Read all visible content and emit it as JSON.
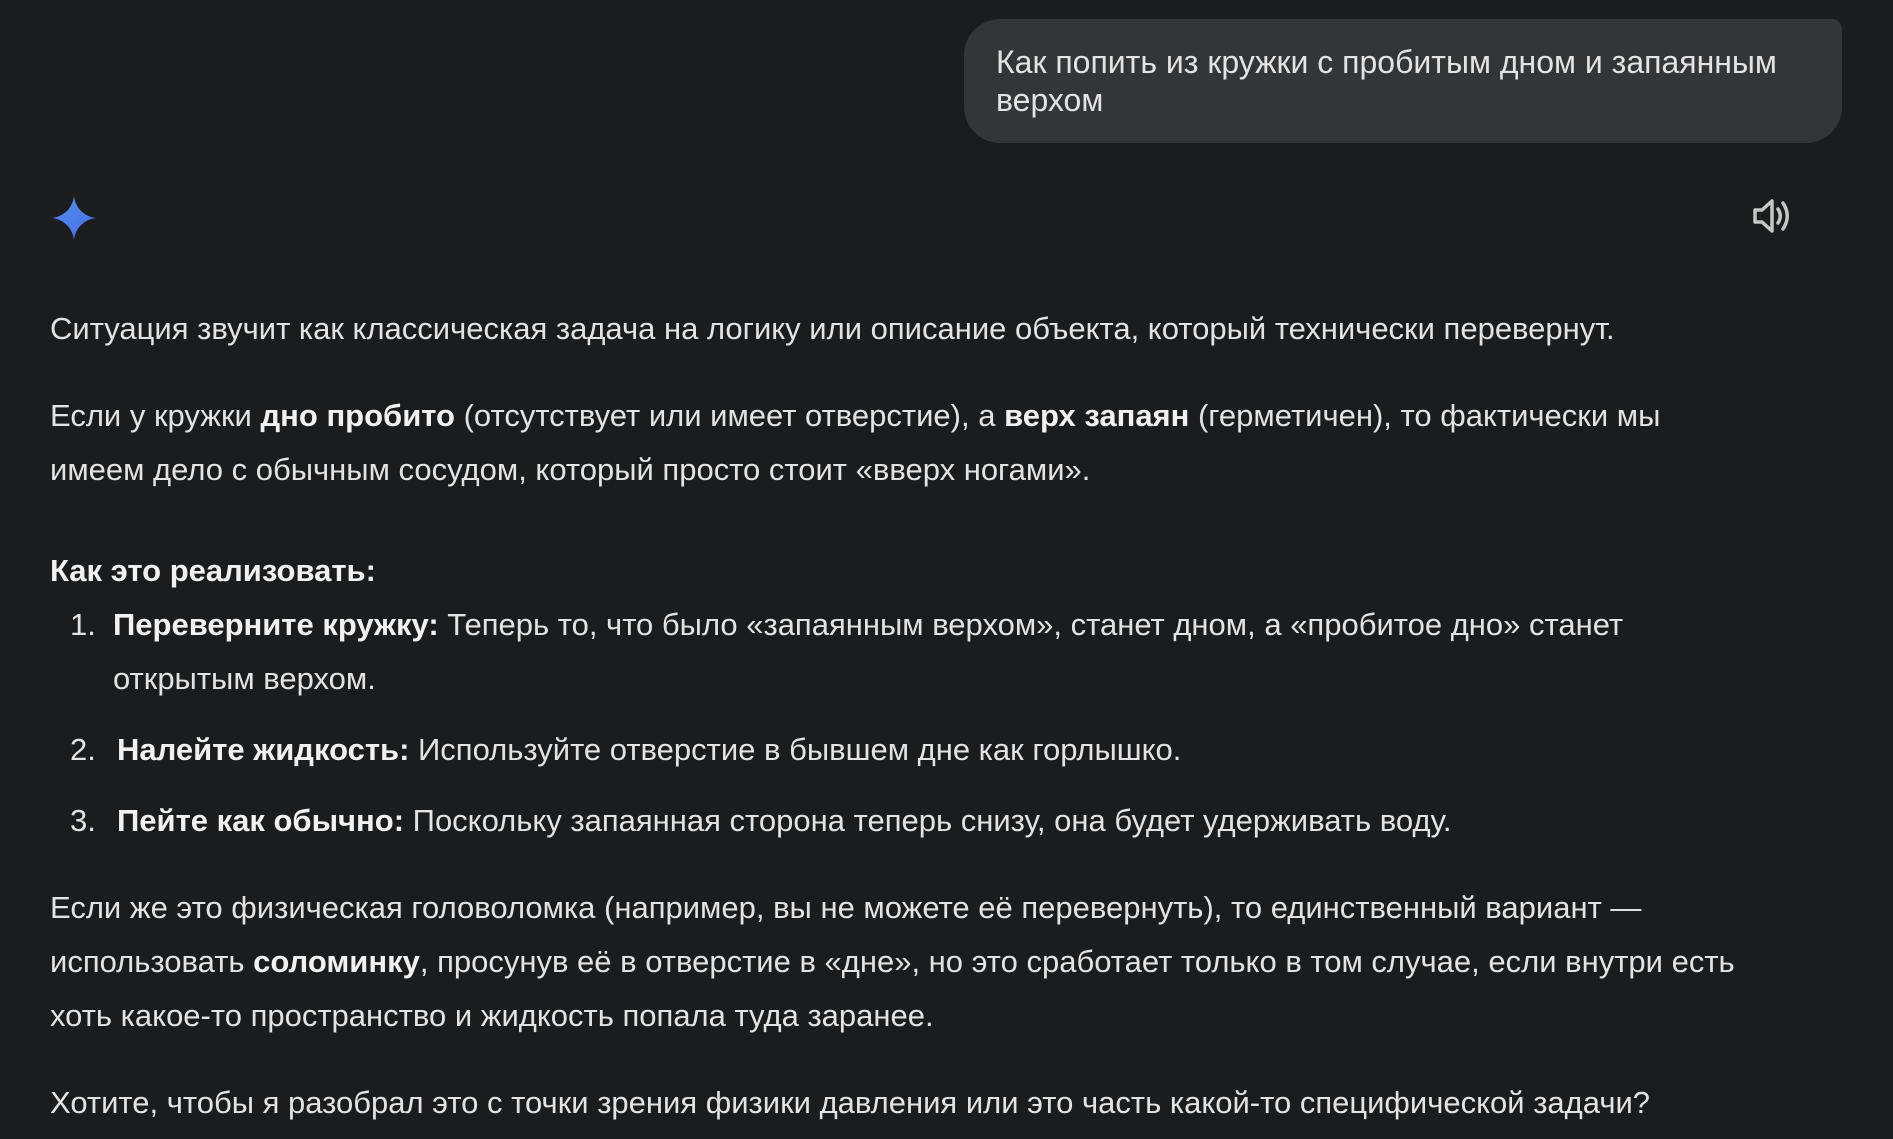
{
  "user_message": {
    "line1": "Как попить из кружки с пробитым дном и запаянным",
    "line2": "верхом"
  },
  "icons": {
    "assistant": "gemini-sparkle-icon",
    "read_aloud": "speaker-icon",
    "accent_color": "#4f83f0"
  },
  "answer": {
    "intro": "Ситуация звучит как классическая задача на логику или описание объекта, который технически перевернут.",
    "p2": {
      "t1": "Если у кружки ",
      "b1": "дно пробито",
      "t2": " (отсутствует или имеет отверстие), а ",
      "b2": "верх запаян",
      "t3": " (герметичен), то фактически мы",
      "line2": "имеем дело с обычным сосудом, который просто стоит «вверх ногами»."
    },
    "howto_heading": "Как это реализовать:",
    "steps": [
      {
        "num": "1.",
        "bold": "Переверните кружку:",
        "text": " Теперь то, что было «запаянным верхом», станет дном, а «пробитое дно» станет",
        "text2": "открытым верхом."
      },
      {
        "num": "2.",
        "bold": "Налейте жидкость:",
        "text": " Используйте отверстие в бывшем дне как горлышко."
      },
      {
        "num": "3.",
        "bold": "Пейте как обычно:",
        "text": " Поскольку запаянная сторона теперь снизу, она будет удерживать воду."
      }
    ],
    "p4": {
      "line1": "Если же это физическая головоломка (например, вы не можете её перевернуть), то единственный вариант —",
      "t1": "использовать ",
      "b1": "соломинку",
      "t2": ", просунув её в отверстие в «дне», но это сработает только в том случае, если внутри есть",
      "line3": "хоть какое-то пространство и жидкость попала туда заранее."
    },
    "closing": "Хотите, чтобы я разобрал это с точки зрения физики давления или это часть какой-то специфической задачи?"
  }
}
